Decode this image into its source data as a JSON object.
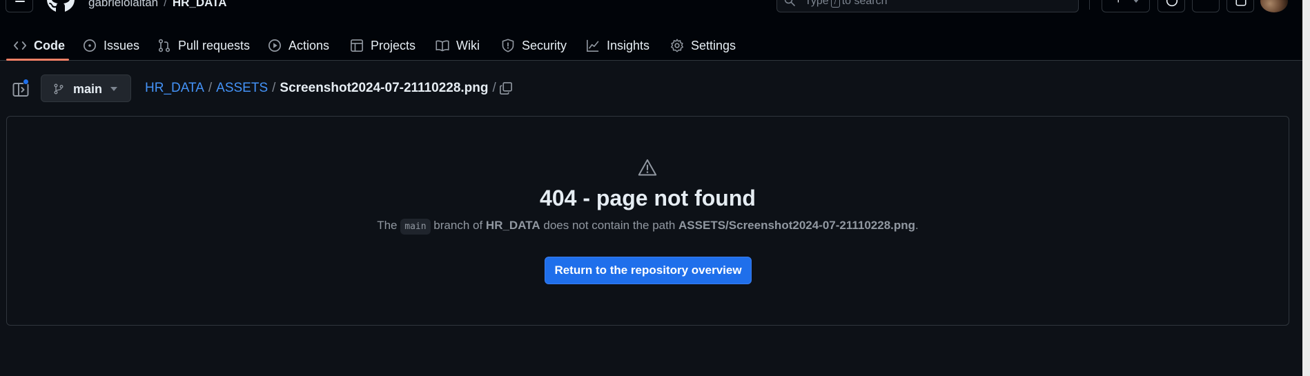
{
  "header": {
    "owner": "gabrielolaitan",
    "separator": "/",
    "repo": "HR_DATA",
    "search_placeholder_pre": "Type",
    "search_key": "/",
    "search_placeholder_post": "to search",
    "plus_label": "+"
  },
  "tabs": [
    {
      "label": "Code",
      "icon": "code-icon"
    },
    {
      "label": "Issues",
      "icon": "issue-icon"
    },
    {
      "label": "Pull requests",
      "icon": "pull-request-icon"
    },
    {
      "label": "Actions",
      "icon": "play-icon"
    },
    {
      "label": "Projects",
      "icon": "table-icon"
    },
    {
      "label": "Wiki",
      "icon": "book-icon"
    },
    {
      "label": "Security",
      "icon": "shield-icon"
    },
    {
      "label": "Insights",
      "icon": "graph-icon"
    },
    {
      "label": "Settings",
      "icon": "gear-icon"
    }
  ],
  "crumbbar": {
    "branch": "main",
    "path": {
      "root": "HR_DATA",
      "folder": "ASSETS",
      "file": "Screenshot2024-07-21110228.png",
      "sep": "/"
    }
  },
  "error": {
    "title": "404 - page not found",
    "msg_the": "The",
    "msg_branch": "main",
    "msg_branch_of": "branch of",
    "msg_repo": "HR_DATA",
    "msg_no_path": "does not contain the path",
    "msg_path": "ASSETS/Screenshot2024-07-21110228.png",
    "msg_end": ".",
    "button": "Return to the repository overview"
  },
  "colors": {
    "accent_link": "#4493f8",
    "primary_button": "#1f6feb",
    "tab_underline": "#f78166",
    "background": "#0d1117"
  }
}
